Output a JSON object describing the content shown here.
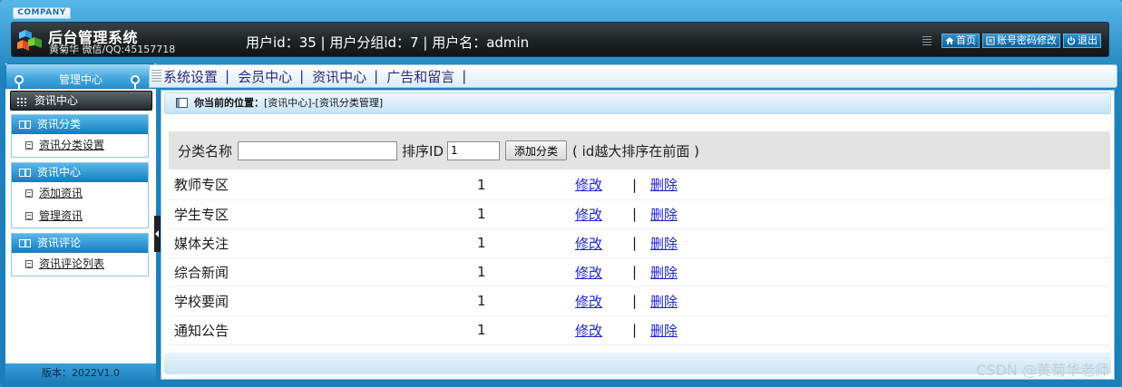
{
  "header": {
    "company_tag": "COMPANY",
    "title": "后台管理系统",
    "subtitle": "黄菊华 微信/QQ:45157718",
    "user_info": "用户id：35 | 用户分组id：7 | 用户名：admin",
    "links": [
      {
        "label": "首页",
        "icon": "home-icon"
      },
      {
        "label": "账号密码修改",
        "icon": "account-icon"
      },
      {
        "label": "退出",
        "icon": "power-icon"
      }
    ]
  },
  "sidebar": {
    "title": "管理中心",
    "active": "资讯中心",
    "groups": [
      {
        "title": "资讯分类",
        "items": [
          "资讯分类设置"
        ]
      },
      {
        "title": "资讯中心",
        "items": [
          "添加资讯",
          "管理资讯"
        ]
      },
      {
        "title": "资讯评论",
        "items": [
          "资讯评论列表"
        ]
      }
    ],
    "version": "版本：2022V1.0"
  },
  "nav": {
    "items": [
      "系统设置",
      "会员中心",
      "资讯中心",
      "广告和留言"
    ],
    "separator": "|"
  },
  "breadcrumb": {
    "label": "你当前的位置：",
    "path": "[资讯中心]-[资讯分类管理]"
  },
  "form": {
    "name_label": "分类名称",
    "name_value": "",
    "id_label": "排序ID",
    "id_value": "1",
    "add_button": "添加分类",
    "hint": "( id越大排序在前面 )"
  },
  "table": {
    "edit_label": "修改",
    "sep": "|",
    "delete_label": "删除",
    "rows": [
      {
        "name": "教师专区",
        "sort_id": "1"
      },
      {
        "name": "学生专区",
        "sort_id": "1"
      },
      {
        "name": "媒体关注",
        "sort_id": "1"
      },
      {
        "name": "综合新闻",
        "sort_id": "1"
      },
      {
        "name": "学校要闻",
        "sort_id": "1"
      },
      {
        "name": "通知公告",
        "sort_id": "1"
      }
    ]
  },
  "watermark": "CSDN @黄菊华老师"
}
